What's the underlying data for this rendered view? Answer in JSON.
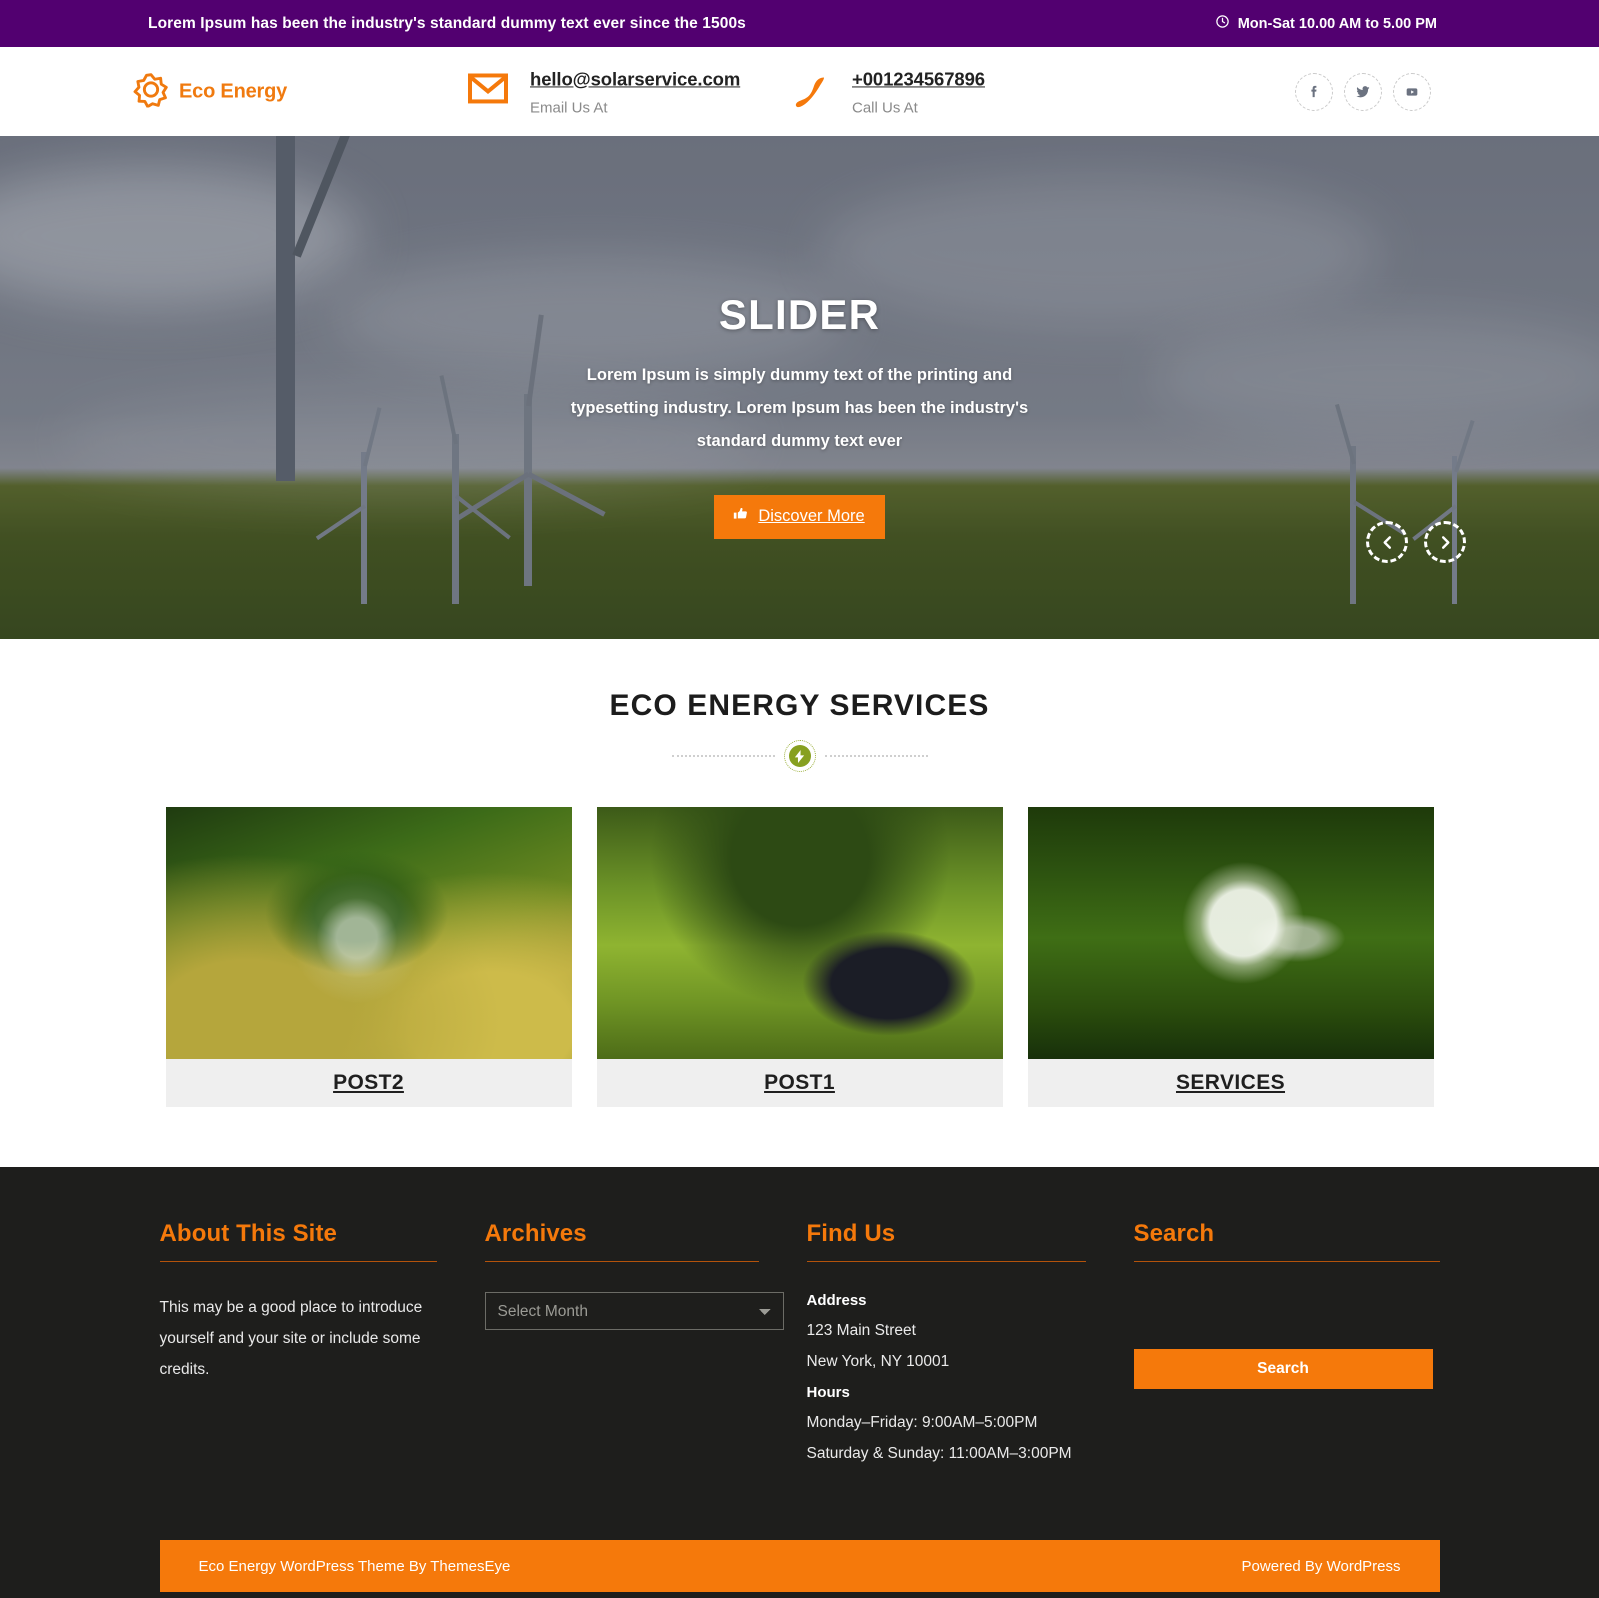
{
  "topbar": {
    "message": "Lorem Ipsum has been the industry's standard dummy text ever since the 1500s",
    "hours": "Mon-Sat 10.00 AM to 5.00 PM",
    "clock_icon": "clock-icon",
    "bg_color": "#520070"
  },
  "header": {
    "logo": {
      "icon": "sun-gear-icon",
      "text": "Eco Energy",
      "color": "#F07A0F"
    },
    "email": {
      "icon": "envelope-icon",
      "value": "hello@solarservice.com",
      "label": "Email Us At"
    },
    "phone": {
      "icon": "phone-icon",
      "value": "+001234567896",
      "label": "Call Us At"
    },
    "socials": [
      {
        "name": "facebook-icon",
        "glyph": "f"
      },
      {
        "name": "twitter-icon",
        "glyph": "t"
      },
      {
        "name": "youtube-icon",
        "glyph": "y"
      }
    ]
  },
  "slider": {
    "title": "SLIDER",
    "description": "Lorem Ipsum is simply dummy text of the printing and typesetting industry. Lorem Ipsum has been the industry's standard dummy text ever",
    "button": {
      "label": "Discover More",
      "icon": "hand-point-right-icon",
      "color": "#F5790B"
    },
    "prev_icon": "chevron-left-icon",
    "next_icon": "chevron-right-icon"
  },
  "services": {
    "heading": "ECO ENERGY SERVICES",
    "divider_icon": "lightning-bolt-badge-icon",
    "divider_color": "#87A020",
    "cards": [
      {
        "title": "POST2",
        "image": "tree-in-glass-globe-photo"
      },
      {
        "title": "POST1",
        "image": "laptop-on-grass-photo"
      },
      {
        "title": "SERVICES",
        "image": "light-bulb-in-grass-photo"
      }
    ]
  },
  "footer": {
    "accent_color": "#F5790B",
    "bg_color": "#1E1E1C",
    "about": {
      "title": "About This Site",
      "text": "This may be a good place to introduce yourself and your site or include some credits."
    },
    "archives": {
      "title": "Archives",
      "select_placeholder": "Select Month",
      "options": [
        "Select Month"
      ]
    },
    "find_us": {
      "title": "Find Us",
      "address_label": "Address",
      "address_line1": "123 Main Street",
      "address_line2": "New York, NY 10001",
      "hours_label": "Hours",
      "hours_line1": "Monday–Friday: 9:00AM–5:00PM",
      "hours_line2": "Saturday & Sunday: 11:00AM–3:00PM"
    },
    "search": {
      "title": "Search",
      "input_value": "",
      "input_placeholder": "",
      "button_label": "Search"
    },
    "bottom": {
      "left": "Eco Energy WordPress Theme By ThemesEye",
      "right": "Powered By WordPress"
    }
  }
}
